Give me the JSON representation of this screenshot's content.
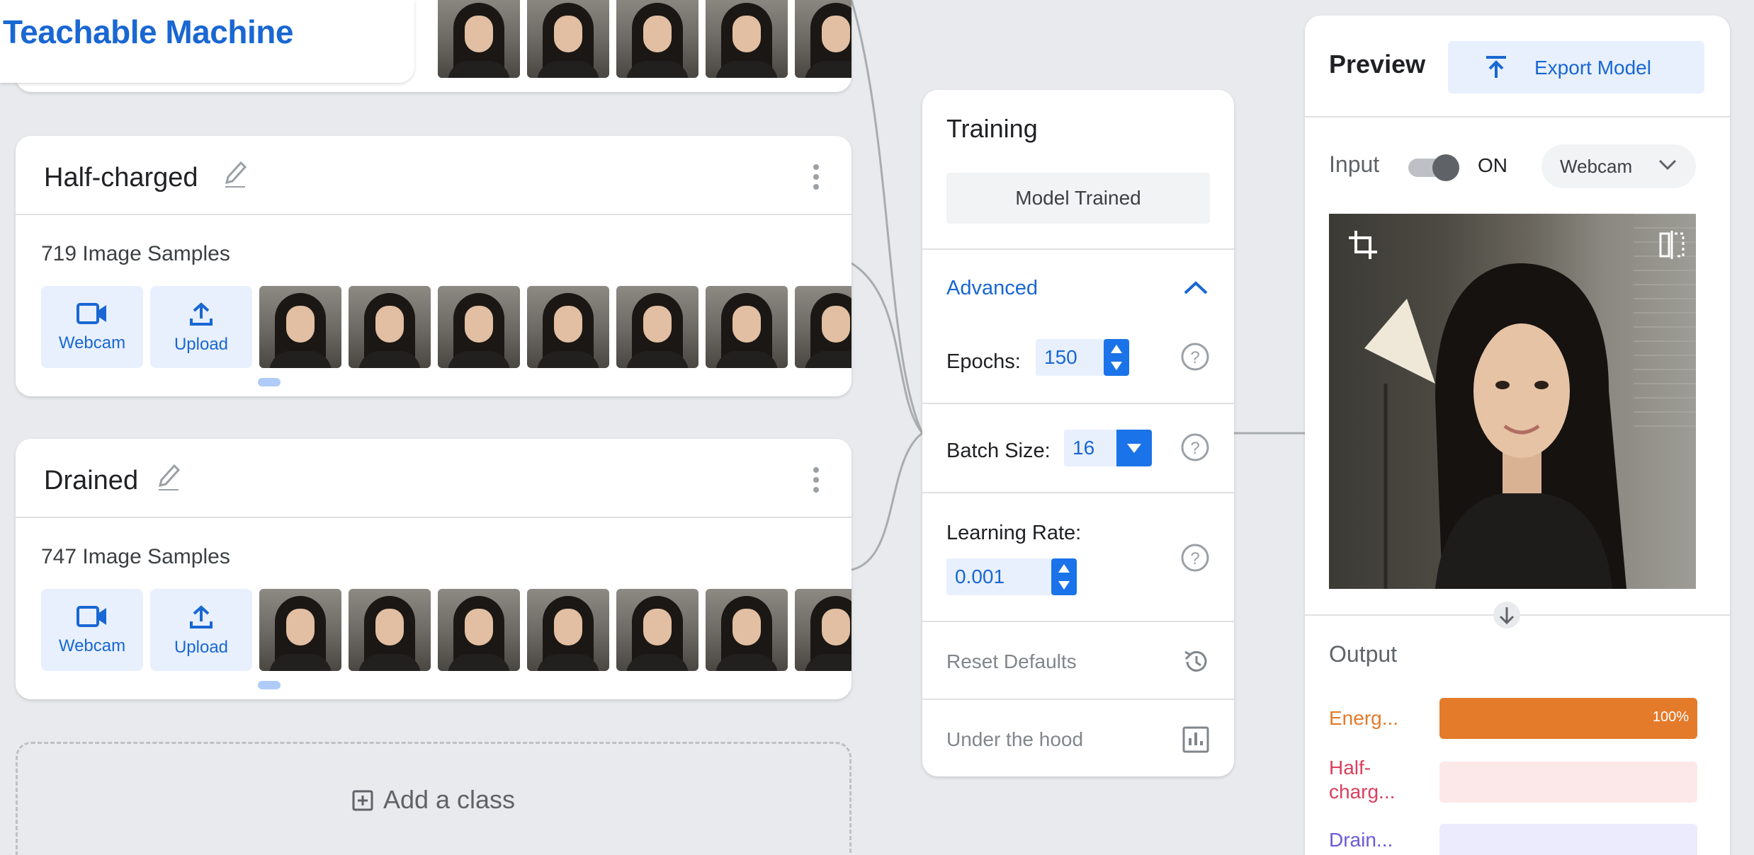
{
  "app": {
    "title": "Teachable Machine"
  },
  "classes": [
    {
      "name": "Half-charged",
      "samples_label": "719 Image Samples",
      "webcam_label": "Webcam",
      "upload_label": "Upload"
    },
    {
      "name": "Drained",
      "samples_label": "747 Image Samples",
      "webcam_label": "Webcam",
      "upload_label": "Upload"
    }
  ],
  "add_class": {
    "label": "Add a class"
  },
  "training": {
    "title": "Training",
    "status_button": "Model Trained",
    "advanced_label": "Advanced",
    "epochs_label": "Epochs:",
    "epochs_value": "150",
    "batch_label": "Batch Size:",
    "batch_value": "16",
    "lr_label": "Learning Rate:",
    "lr_value": "0.001",
    "reset_label": "Reset Defaults",
    "hood_label": "Under the hood"
  },
  "preview": {
    "title": "Preview",
    "export_label": "Export Model",
    "input_label": "Input",
    "toggle_state": "ON",
    "camera_select": "Webcam",
    "output_label": "Output",
    "outputs": [
      {
        "label": "Energ...",
        "percent": 100,
        "percent_label": "100%",
        "color": "#e37b2b",
        "track": "#fce8d7"
      },
      {
        "label": "Half-\ncharg...",
        "percent": 0,
        "percent_label": "",
        "color": "#d9405e",
        "track": "#fce8e8"
      },
      {
        "label": "Drain...",
        "percent": 0,
        "percent_label": "",
        "color": "#6a5ad9",
        "track": "#ecebfd"
      }
    ]
  },
  "colors": {
    "accent": "#1967d2",
    "accent_strong": "#1a73e8",
    "background": "#e8eaed"
  }
}
